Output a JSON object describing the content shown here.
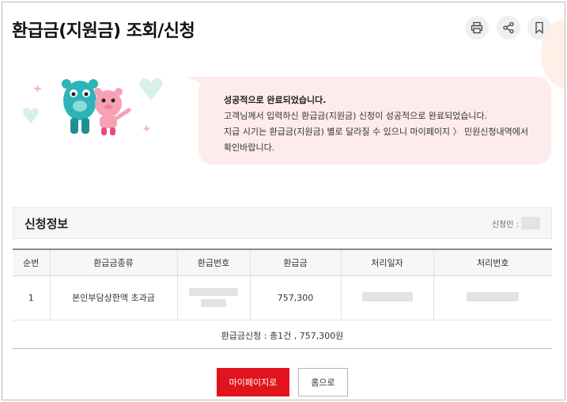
{
  "page": {
    "title": "환급금(지원금) 조회/신청"
  },
  "toolbar": {
    "print_icon": "printer-icon",
    "share_icon": "share-icon",
    "bookmark_icon": "bookmark-icon"
  },
  "notice": {
    "headline": "성공적으로 완료되었습니다.",
    "line1": "고객님께서 입력하신 환급금(지원금) 신청이 성공적으로 완료되었습니다.",
    "line2": "지급 시기는 환급금(지원금) 별로 달라질 수 있으니 마이페이지 〉 민원신청내역에서",
    "line3": "확인바랍니다."
  },
  "section": {
    "title": "신청정보",
    "applicant_label": "신청인 :"
  },
  "table": {
    "headers": [
      "순번",
      "환급금종류",
      "환급번호",
      "환급금",
      "처리일자",
      "처리번호"
    ],
    "rows": [
      {
        "no": "1",
        "type": "본인부담상한액 초과금",
        "amount": "757,300"
      }
    ]
  },
  "summary": "환급금신청 : 총1건 , 757,300원",
  "buttons": {
    "mypage": "마이페이지로",
    "home": "홈으로"
  },
  "colors": {
    "primary": "#e1141e",
    "bubble": "#fdeceb",
    "mascot_teal": "#2bb5b8",
    "mascot_pink": "#f7a1b5"
  }
}
